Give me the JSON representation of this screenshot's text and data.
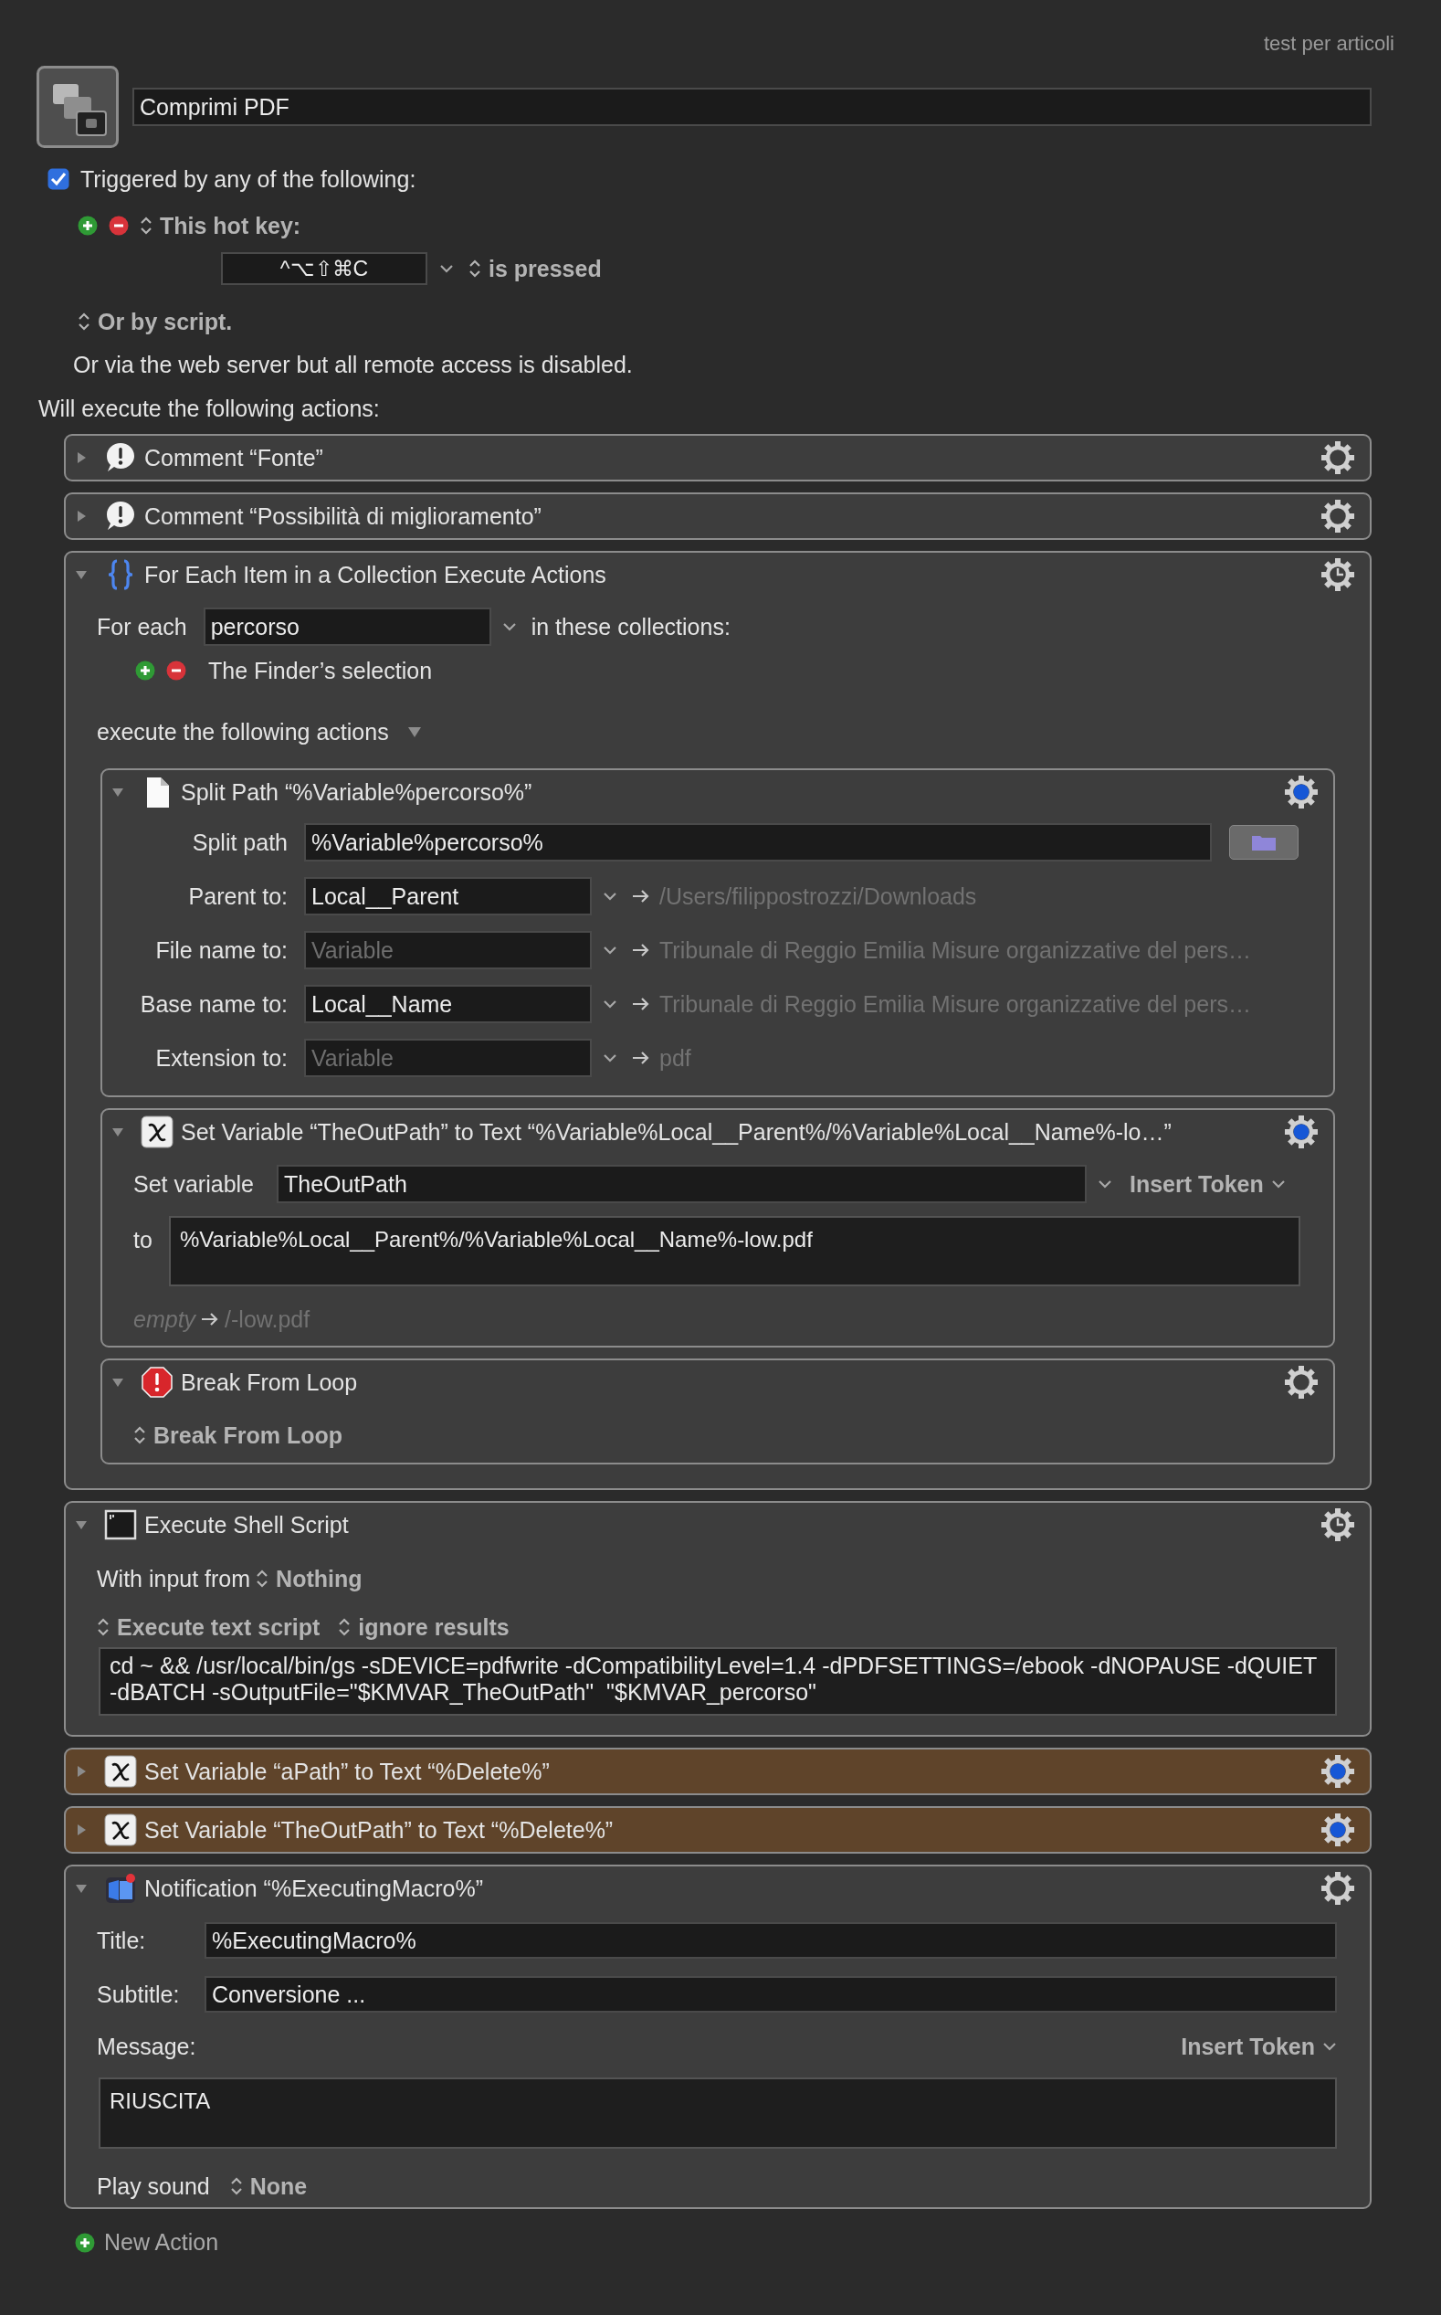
{
  "group_label": "test per articoli",
  "macro": {
    "name": "Comprimi PDF"
  },
  "trigger_header": {
    "label": "Triggered by any of the following:",
    "checked": true
  },
  "triggers": [
    {
      "kind": "hot_key",
      "label": "This hot key:",
      "keys": "^⌥⇧⌘C",
      "condition": "is pressed"
    }
  ],
  "script_trigger": "Or by script.",
  "web_server_note": "Or via the web server but all remote access is disabled.",
  "actions_label": "Will execute the following actions:",
  "actions": [
    {
      "kind": "comment",
      "title": "Comment “Fonte”",
      "expanded": false,
      "gear_clock": false,
      "gear_dot": false
    },
    {
      "kind": "comment",
      "title": "Comment “Possibilità di miglioramento”",
      "expanded": false,
      "gear_clock": false,
      "gear_dot": false
    },
    {
      "kind": "for_each",
      "title": "For Each Item in a Collection Execute Actions",
      "expanded": true,
      "gear_clock": true,
      "gear_dot": false,
      "variable_label": "For each",
      "variable": "percorso",
      "collections_label": "in these collections:",
      "collections": [
        "The Finder’s selection"
      ],
      "execute_label": "execute the following actions",
      "actions": [
        {
          "kind": "split_path",
          "title": "Split Path “%Variable%percorso%”",
          "expanded": true,
          "gear_clock": false,
          "gear_dot": true,
          "path_label": "Split path",
          "path": "%Variable%percorso%",
          "outputs": [
            {
              "label": "Parent to:",
              "value": "Local__Parent",
              "result": "/Users/filippostrozzi/Downloads"
            },
            {
              "label": "File name to:",
              "placeholder": "Variable",
              "result": "Tribunale di Reggio Emilia Misure organizzative del pers…"
            },
            {
              "label": "Base name to:",
              "value": "Local__Name",
              "result": "Tribunale di Reggio Emilia Misure organizzative del pers…"
            },
            {
              "label": "Extension to:",
              "placeholder": "Variable",
              "result": "pdf"
            }
          ]
        },
        {
          "kind": "set_variable",
          "title": "Set Variable “TheOutPath” to Text “%Variable%Local__Parent%/%Variable%Local__Name%-lo…”",
          "expanded": true,
          "gear_clock": false,
          "gear_dot": true,
          "variable_label": "Set variable",
          "variable": "TheOutPath",
          "insert_token": "Insert Token",
          "text_label": "to",
          "text": "%Variable%Local__Parent%/%Variable%Local__Name%-low.pdf",
          "preview_empty": "empty",
          "preview": "/-low.pdf"
        },
        {
          "kind": "break",
          "title": "Break From Loop",
          "expanded": true,
          "gear_clock": false,
          "gear_dot": false,
          "mode": "Break From Loop"
        }
      ]
    },
    {
      "kind": "shell",
      "title": "Execute Shell Script",
      "expanded": true,
      "gear_clock": true,
      "gear_dot": false,
      "input_label": "With input from",
      "input": "Nothing",
      "script_mode": "Execute text script",
      "results": "ignore results",
      "script": "cd ~ && /usr/local/bin/gs -sDEVICE=pdfwrite -dCompatibilityLevel=1.4 -dPDFSETTINGS=/ebook -dNOPAUSE -dQUIET -dBATCH -sOutputFile=\"$KMVAR_TheOutPath\"  \"$KMVAR_percorso\""
    },
    {
      "kind": "set_variable",
      "title": "Set Variable “aPath” to Text “%Delete%”",
      "expanded": false,
      "gear_clock": false,
      "gear_dot": true,
      "color": "#5f442a"
    },
    {
      "kind": "set_variable",
      "title": "Set Variable “TheOutPath” to Text “%Delete%”",
      "expanded": false,
      "gear_clock": false,
      "gear_dot": true,
      "color": "#5f442a"
    },
    {
      "kind": "notification",
      "title": "Notification “%ExecutingMacro%”",
      "expanded": true,
      "gear_clock": false,
      "gear_dot": false,
      "title_label": "Title:",
      "notification_title": "%ExecutingMacro%",
      "subtitle_label": "Subtitle:",
      "subtitle": "Conversione ...",
      "message_label": "Message:",
      "insert_token": "Insert Token",
      "message": "RIUSCITA",
      "sound_label": "Play sound",
      "sound": "None"
    }
  ],
  "new_action": "New Action"
}
